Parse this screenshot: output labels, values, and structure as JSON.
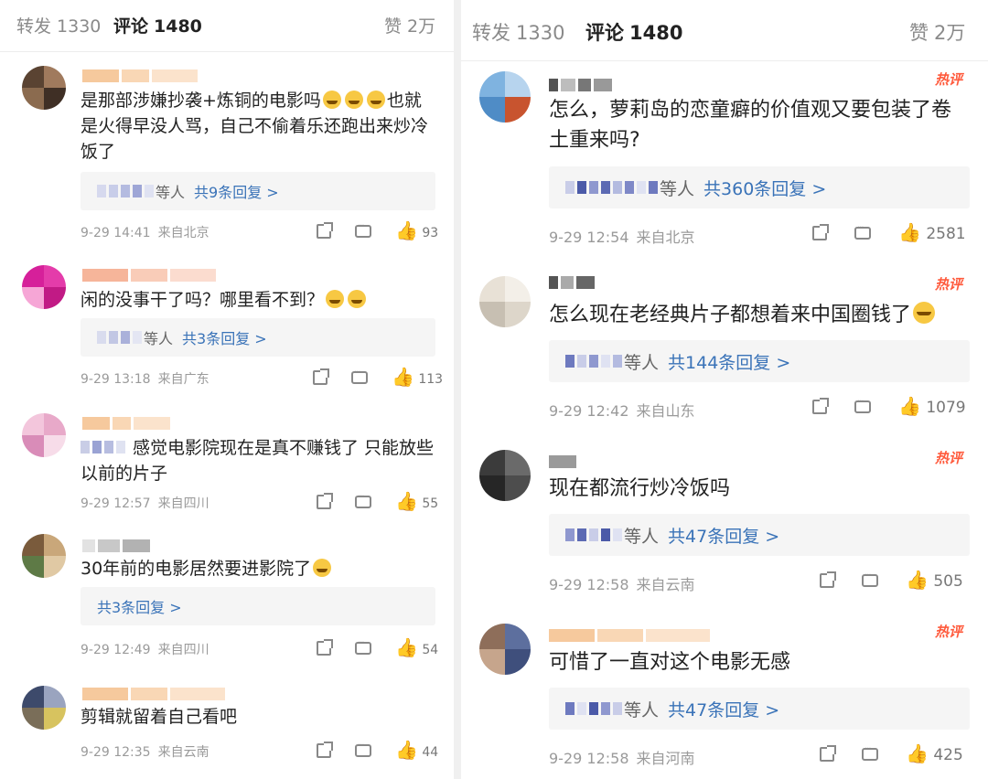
{
  "left": {
    "tabs": {
      "repost": "转发",
      "repost_count": "1330",
      "comment": "评论",
      "comment_count": "1480",
      "like": "赞",
      "like_count": "2万"
    },
    "comments": [
      {
        "text": "是那部涉嫌抄袭+炼铜的电影吗",
        "text2": "也就是火得早没人骂，自己不偷着乐还跑出来炒冷饭了",
        "reply_who": "等人",
        "reply_link": "共9条回复 >",
        "time": "9-29 14:41",
        "loc": "来自北京",
        "likes": "93"
      },
      {
        "text": "闲的没事干了吗？哪里看不到？",
        "reply_who": "等人",
        "reply_link": "共3条回复 >",
        "time": "9-29 13:18",
        "loc": "来自广东",
        "likes": "113"
      },
      {
        "text": "感觉电影院现在是真不赚钱了 只能放些以前的片子",
        "time": "9-29 12:57",
        "loc": "来自四川",
        "likes": "55"
      },
      {
        "text": "30年前的电影居然要进影院了",
        "reply_who": "",
        "reply_link": "共3条回复 >",
        "time": "9-29 12:49",
        "loc": "来自四川",
        "likes": "54"
      },
      {
        "text": "剪辑就留着自己看吧",
        "time": "9-29 12:35",
        "loc": "来自云南",
        "likes": "44"
      }
    ]
  },
  "right": {
    "tabs": {
      "repost": "转发",
      "repost_count": "1330",
      "comment": "评论",
      "comment_count": "1480",
      "like": "赞",
      "like_count": "2万"
    },
    "hot_label": "热评",
    "comments": [
      {
        "text": "怎么，萝莉岛的恋童癖的价值观又要包装了卷土重来吗?",
        "reply_who": "等人",
        "reply_link": "共360条回复 >",
        "time": "9-29 12:54",
        "loc": "来自北京",
        "likes": "2581"
      },
      {
        "text": "怎么现在老经典片子都想着来中国圈钱了",
        "reply_who": "等人",
        "reply_link": "共144条回复 >",
        "time": "9-29 12:42",
        "loc": "来自山东",
        "likes": "1079"
      },
      {
        "text": "现在都流行炒冷饭吗",
        "reply_who": "等人",
        "reply_link": "共47条回复 >",
        "time": "9-29 12:58",
        "loc": "来自云南",
        "likes": "505"
      },
      {
        "text": "可惜了一直对这个电影无感",
        "reply_who": "等人",
        "reply_link": "共47条回复 >",
        "time": "9-29 12:58",
        "loc": "来自河南",
        "likes": "425"
      }
    ]
  },
  "icons": {
    "share": "share-icon",
    "comment": "comment-icon",
    "like": "thumbs-up-icon",
    "emoji": "grin-emoji-icon"
  },
  "colors": {
    "hot": "#ff5a3c",
    "link": "#3a73b8",
    "reply_bg": "#f5f5f5",
    "meta": "#9a9a9a"
  }
}
